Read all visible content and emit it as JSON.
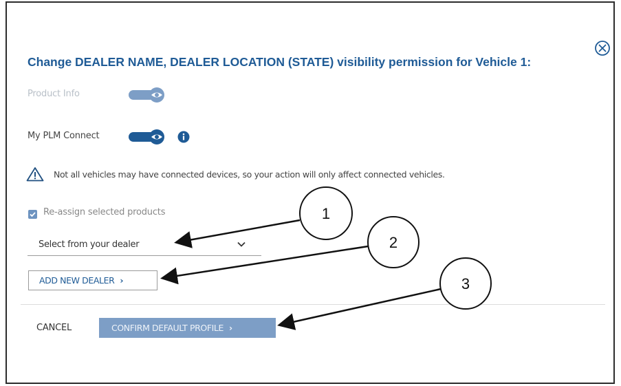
{
  "dialog": {
    "title": "Change DEALER NAME, DEALER LOCATION (STATE) visibility permission for Vehicle 1:",
    "close_icon": "close-circle-icon"
  },
  "rows": [
    {
      "label": "Product Info",
      "toggle_state": "on",
      "enabled": false
    },
    {
      "label": "My PLM Connect",
      "toggle_state": "on",
      "enabled": true,
      "info_icon": "info-icon"
    }
  ],
  "warning": {
    "icon": "warning-triangle-icon",
    "text": "Not all vehicles may have connected devices, so your action will only affect connected vehicles."
  },
  "reassign": {
    "checked": true,
    "label": "Re-assign selected products"
  },
  "dealer_select": {
    "value": "Select from your dealer",
    "icon": "chevron-down-icon"
  },
  "add_dealer_button": {
    "label": "ADD NEW DEALER",
    "icon": "chevron-right-icon"
  },
  "footer": {
    "cancel_label": "CANCEL",
    "confirm_label": "CONFIRM DEFAULT PROFILE",
    "confirm_icon": "chevron-right-icon"
  },
  "callouts": [
    "1",
    "2",
    "3"
  ],
  "colors": {
    "title": "#1f5b96",
    "toggle_active": "#1f5b96",
    "toggle_disabled": "#7d9ec6",
    "confirm_button": "#7d9ec6",
    "checkbox": "#6d93c0"
  }
}
